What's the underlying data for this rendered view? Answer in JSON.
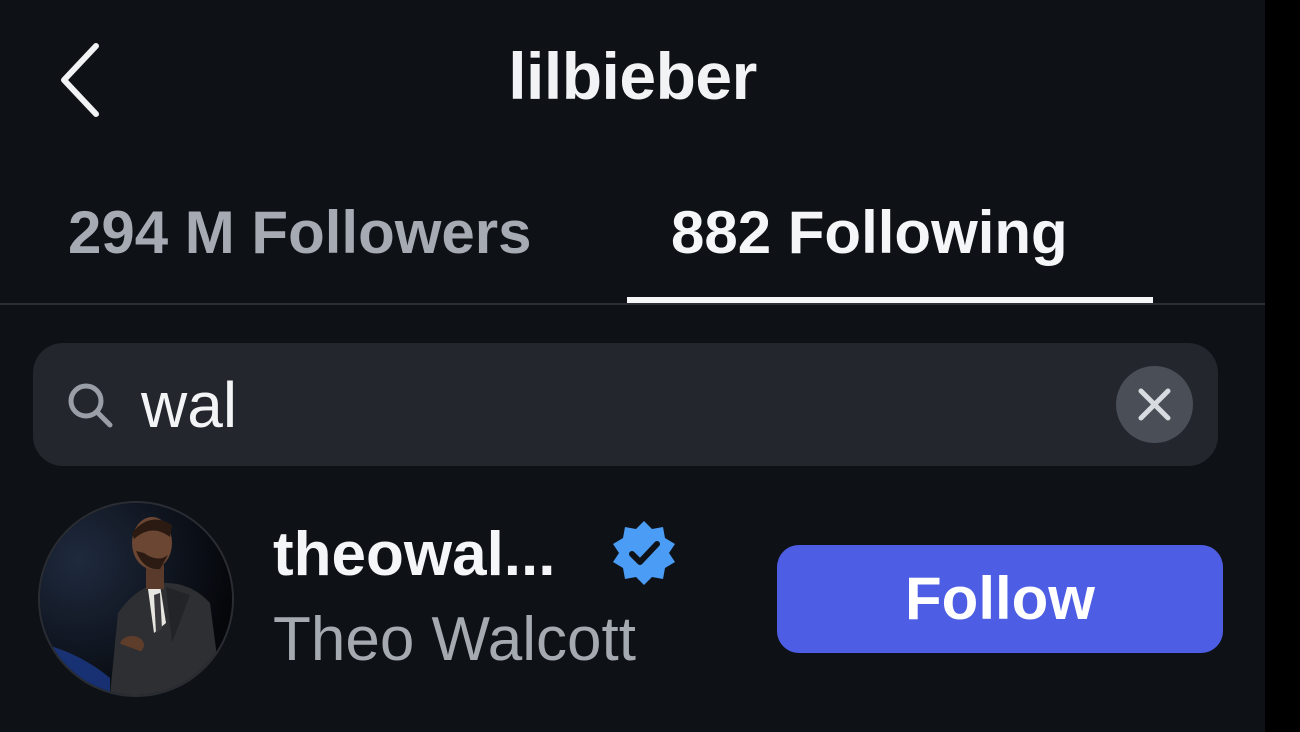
{
  "header": {
    "title": "lilbieber",
    "back_icon": "chevron-left-icon"
  },
  "tabs": [
    {
      "label": "294 M Followers",
      "active": false
    },
    {
      "label": "882 Following",
      "active": true
    }
  ],
  "search": {
    "value": "wal",
    "icon": "search-icon",
    "clear_icon": "close-icon"
  },
  "results": [
    {
      "username": "theowal...",
      "verified": true,
      "display_name": "Theo Walcott",
      "action_label": "Follow"
    }
  ],
  "colors": {
    "background": "#0e1116",
    "text_primary": "#f5f6f8",
    "text_secondary": "#a5a9b0",
    "search_bg": "#23262c",
    "follow_button": "#4e5ee4",
    "verified_badge": "#4a9cf5"
  }
}
